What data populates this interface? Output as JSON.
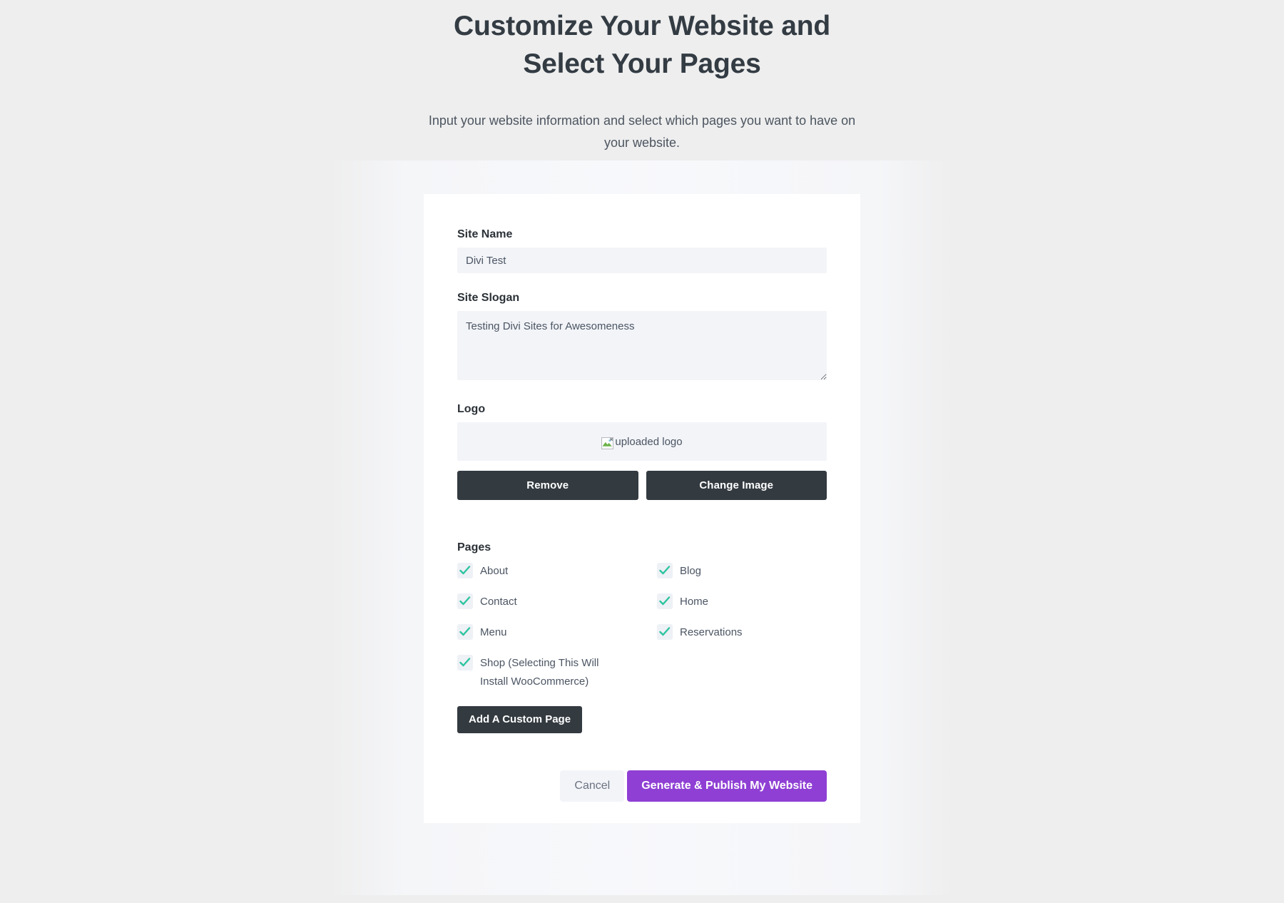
{
  "header": {
    "title_line1": "Customize Your Website and",
    "title_line2": "Select Your Pages",
    "subtitle": "Input your website information and select which pages you want to have on your website."
  },
  "form": {
    "site_name": {
      "label": "Site Name",
      "value": "Divi Test",
      "placeholder": ""
    },
    "site_slogan": {
      "label": "Site Slogan",
      "value": "Testing Divi Sites for Awesomeness",
      "placeholder": ""
    },
    "logo": {
      "label": "Logo",
      "alt_text": "uploaded logo",
      "icon": "broken-image-icon",
      "remove_label": "Remove",
      "change_label": "Change Image"
    }
  },
  "pages": {
    "label": "Pages",
    "options": [
      {
        "label": "About",
        "checked": true,
        "column": 1
      },
      {
        "label": "Blog",
        "checked": true,
        "column": 2
      },
      {
        "label": "Contact",
        "checked": true,
        "column": 1
      },
      {
        "label": "Home",
        "checked": true,
        "column": 2
      },
      {
        "label": "Menu",
        "checked": true,
        "column": 1
      },
      {
        "label": "Reservations",
        "checked": true,
        "column": 2
      },
      {
        "label": "Shop (Selecting This Will Install WooCommerce)",
        "checked": true,
        "column": 1
      }
    ],
    "add_custom_label": "Add A Custom Page"
  },
  "actions": {
    "cancel_label": "Cancel",
    "submit_label": "Generate & Publish My Website"
  },
  "colors": {
    "page_background": "#eeeeee",
    "card_background": "#ffffff",
    "input_background": "#f2f4f8",
    "dark_button": "#333a40",
    "primary_button": "#8f3fd4",
    "checkbox_check": "#2ec4a0",
    "checkbox_box": "#eef1f6",
    "title_text": "#333b43",
    "body_text": "#4b5563",
    "bottom_bar": "#000000"
  }
}
